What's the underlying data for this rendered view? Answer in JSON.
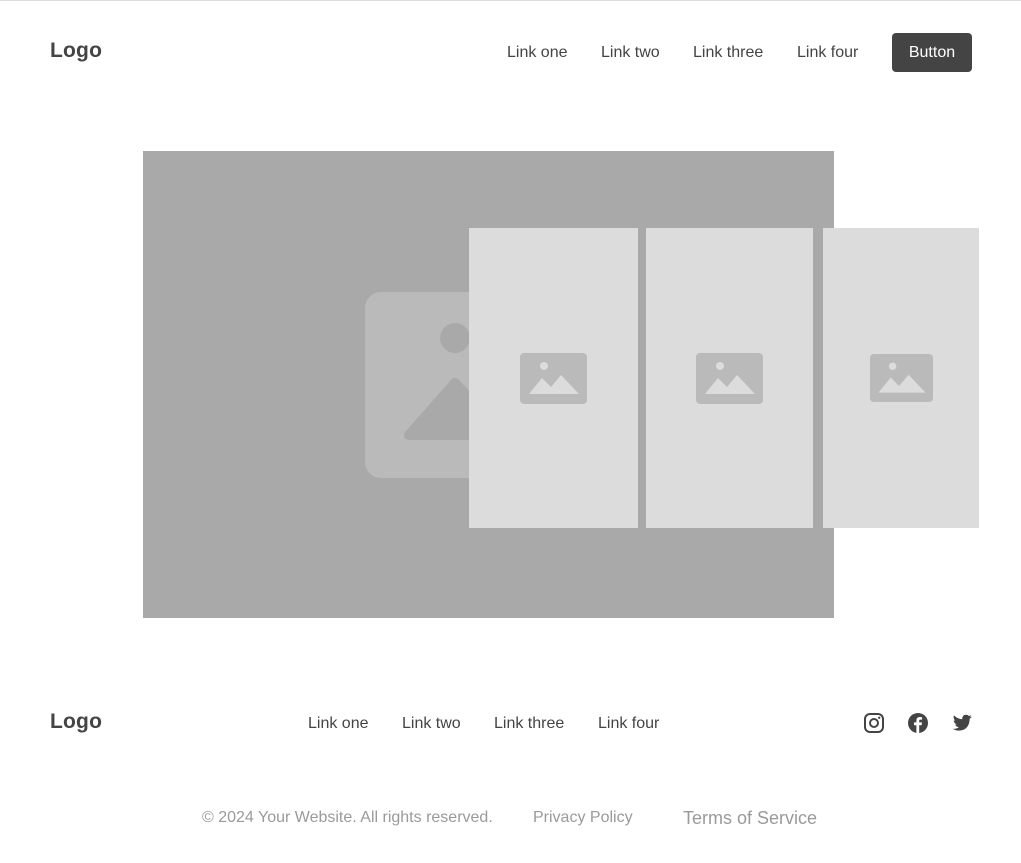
{
  "header": {
    "logo": "Logo",
    "nav": [
      "Link one",
      "Link two",
      "Link three",
      "Link four"
    ],
    "button_label": "Button"
  },
  "hero": {
    "main_image_icon": "image-placeholder-icon",
    "cards": [
      {
        "icon": "image-placeholder-icon"
      },
      {
        "icon": "image-placeholder-icon"
      },
      {
        "icon": "image-placeholder-icon"
      }
    ]
  },
  "footer": {
    "logo": "Logo",
    "nav": [
      "Link one",
      "Link two",
      "Link three",
      "Link four"
    ],
    "social": [
      "instagram-icon",
      "facebook-icon",
      "twitter-icon"
    ],
    "copyright": "© 2024 Your Website. All rights reserved.",
    "privacy_label": "Privacy Policy",
    "terms_label": "Terms of Service"
  },
  "colors": {
    "text": "#444444",
    "button_bg": "#444444",
    "button_text": "#ffffff",
    "hero_bg": "#a9a9a9",
    "card_bg": "#dcdcdc",
    "placeholder_icon": "#bababa",
    "muted_text": "#9a9a9a"
  }
}
